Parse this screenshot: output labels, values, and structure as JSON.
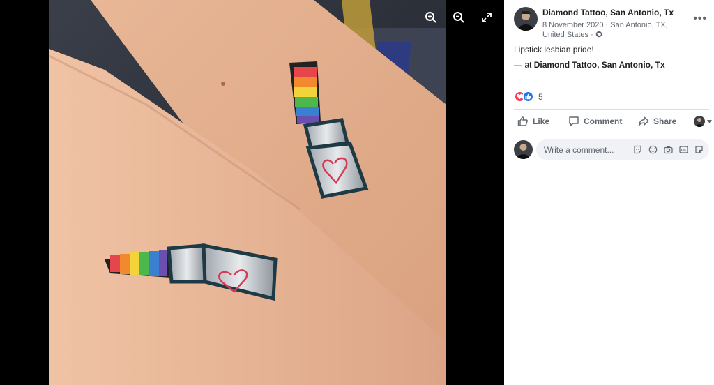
{
  "viewer": {
    "photo_alt": "Two forearms with matching rainbow lipstick tattoos, each with a red heart on the tube",
    "tools": [
      "zoom-in-icon",
      "zoom-out-icon",
      "fullscreen-icon"
    ]
  },
  "post": {
    "page_name": "Diamond Tattoo, San Antonio, Tx",
    "date": "8 November 2020",
    "location": "San Antonio, TX, United States",
    "separator": "·",
    "audience_icon": "globe-icon",
    "more_label": "•••",
    "caption": "Lipstick lesbian pride!",
    "checkin_prefix": "— at ",
    "checkin_place": "Diamond Tattoo, San Antonio, Tx"
  },
  "reactions": {
    "types": [
      "love-icon",
      "like-icon"
    ],
    "count": "5"
  },
  "actions": {
    "like_label": "Like",
    "comment_label": "Comment",
    "share_label": "Share"
  },
  "composer": {
    "placeholder": "Write a comment...",
    "icons": [
      "sticker-icon",
      "emoji-icon",
      "camera-icon",
      "gif-icon",
      "sticker-alt-icon"
    ]
  },
  "colors": {
    "brand_blue": "#1877f2",
    "love_red": "#f33e58",
    "text_primary": "#1c1e21",
    "text_secondary": "#606770"
  }
}
